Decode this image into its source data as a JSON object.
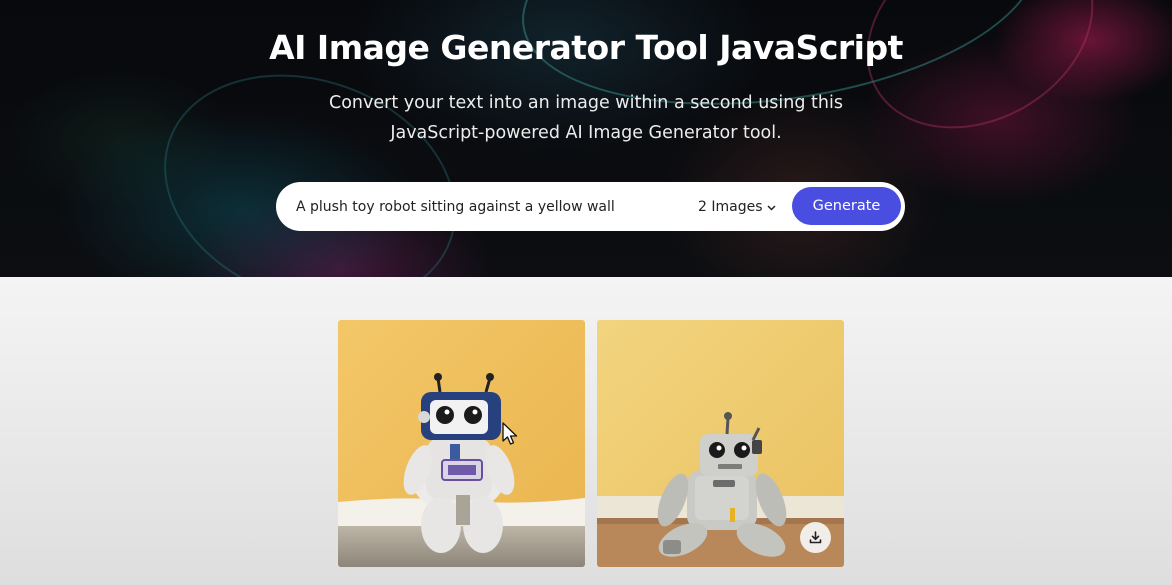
{
  "hero": {
    "title": "AI Image Generator Tool JavaScript",
    "subtitle_line1": "Convert your text into an image within a second using this",
    "subtitle_line2": "JavaScript-powered AI Image Generator tool."
  },
  "form": {
    "prompt_value": "A plush toy robot sitting against a yellow wall",
    "image_count_selected": "2 Images",
    "generate_label": "Generate"
  },
  "gallery": {
    "images": [
      {
        "subject": "plush toy robot with blue head against yellow wall",
        "icon": "image"
      },
      {
        "subject": "plush toy robot with grey head against yellow wall",
        "icon": "image",
        "download_icon": "download-icon"
      }
    ]
  },
  "colors": {
    "accent": "#4a4ee0",
    "wall_yellow": "#f1c55e"
  }
}
